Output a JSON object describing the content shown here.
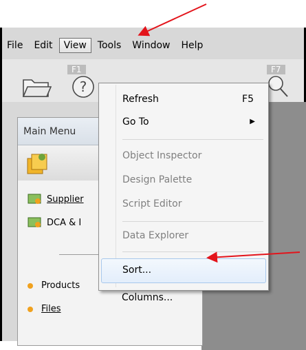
{
  "menubar": {
    "file": "File",
    "edit": "Edit",
    "view": "View",
    "tools": "Tools",
    "window": "Window",
    "help": "Help"
  },
  "toolbar": {
    "fkey_left": "F1",
    "fkey_right": "F7"
  },
  "main_menu": {
    "title": "Main Menu",
    "items": [
      "Supplier",
      "DCA & I",
      "Products",
      "Files"
    ]
  },
  "view_menu": {
    "refresh": "Refresh",
    "refresh_shortcut": "F5",
    "goto": "Go To",
    "object_inspector": "Object Inspector",
    "design_palette": "Design Palette",
    "script_editor": "Script Editor",
    "data_explorer": "Data Explorer",
    "sort": "Sort...",
    "columns": "Columns..."
  },
  "colors": {
    "annotation_arrow": "#e3141b",
    "highlight_border": "#a8c8ec",
    "bullet": "#f0a11e"
  },
  "icons": [
    "folder-icon",
    "help-icon",
    "magnifier-icon",
    "chevron-right-icon"
  ]
}
